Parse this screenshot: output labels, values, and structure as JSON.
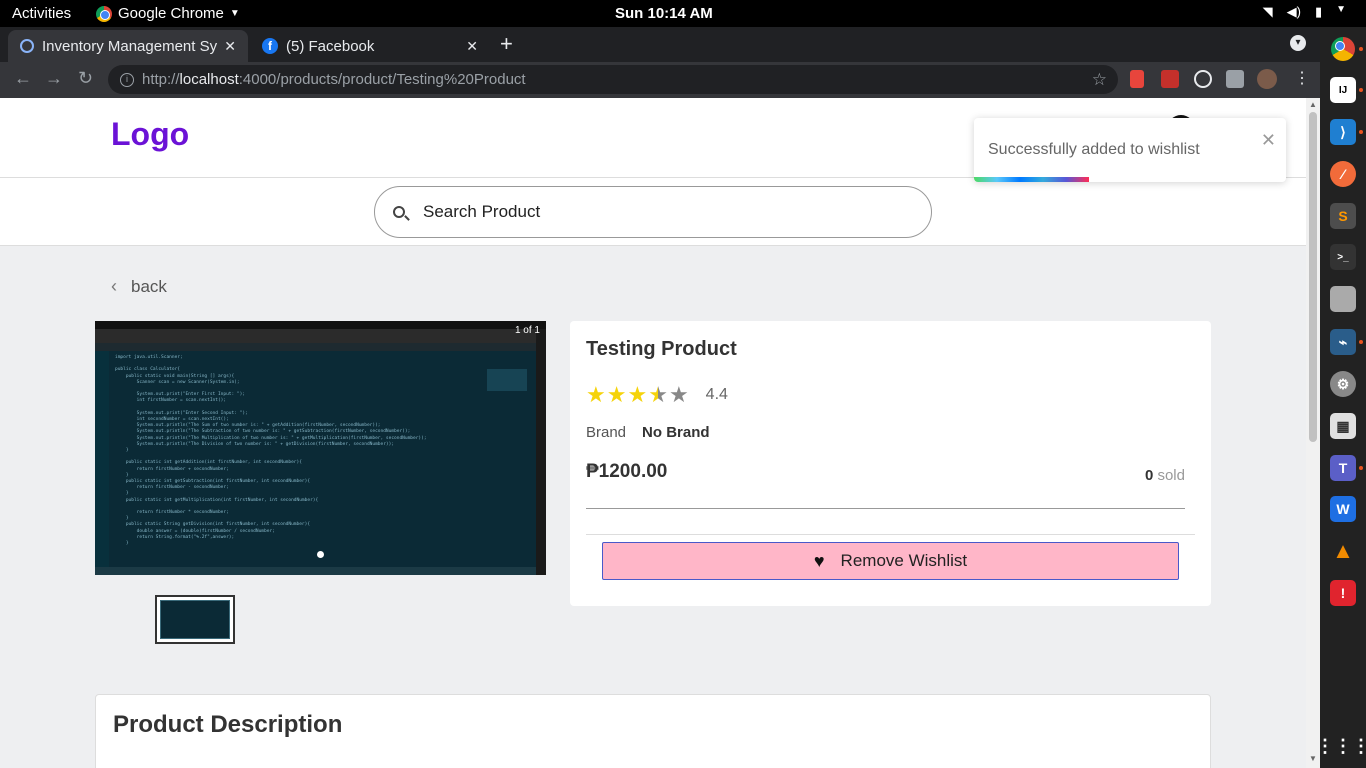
{
  "system": {
    "activities": "Activities",
    "app_menu": "Google Chrome",
    "clock": "Sun 10:14 AM"
  },
  "browser": {
    "tabs": [
      {
        "title": "Inventory Management Sy",
        "active": true
      },
      {
        "title": "(5) Facebook",
        "active": false
      }
    ],
    "url_scheme": "http://",
    "url_host": "localhost",
    "url_rest": ":4000/products/product/Testing%20Product"
  },
  "site": {
    "logo": "Logo",
    "search": {
      "placeholder": "Search Product"
    },
    "back_label": "back"
  },
  "gallery": {
    "counter": "1 of 1"
  },
  "product": {
    "title": "Testing Product",
    "rating": 4.4,
    "rating_label": "4.4",
    "brand_label": "Brand",
    "brand_value": "No Brand",
    "price": "₱1200.00",
    "sold_count": "0",
    "sold_label": "sold",
    "wishlist_button": "Remove Wishlist"
  },
  "description": {
    "title": "Product Description"
  },
  "toast": {
    "message": "Successfully added to wishlist",
    "progress": 0.37
  },
  "colors": {
    "logo": "#6b12d6",
    "wishlist_button_bg": "#ffb6c8",
    "wishlist_button_border": "#4a59c9",
    "star_filled": "#f5d30b",
    "star_empty": "#888888"
  }
}
